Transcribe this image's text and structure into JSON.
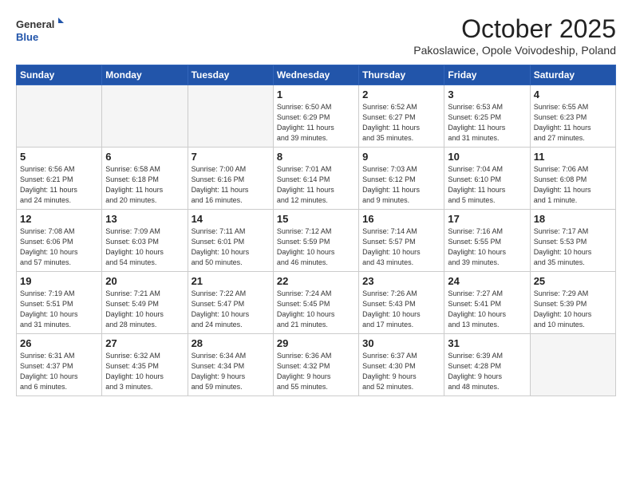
{
  "header": {
    "logo_general": "General",
    "logo_blue": "Blue",
    "title": "October 2025",
    "subtitle": "Pakoslawice, Opole Voivodeship, Poland"
  },
  "weekdays": [
    "Sunday",
    "Monday",
    "Tuesday",
    "Wednesday",
    "Thursday",
    "Friday",
    "Saturday"
  ],
  "weeks": [
    [
      {
        "day": "",
        "info": ""
      },
      {
        "day": "",
        "info": ""
      },
      {
        "day": "",
        "info": ""
      },
      {
        "day": "1",
        "info": "Sunrise: 6:50 AM\nSunset: 6:29 PM\nDaylight: 11 hours\nand 39 minutes."
      },
      {
        "day": "2",
        "info": "Sunrise: 6:52 AM\nSunset: 6:27 PM\nDaylight: 11 hours\nand 35 minutes."
      },
      {
        "day": "3",
        "info": "Sunrise: 6:53 AM\nSunset: 6:25 PM\nDaylight: 11 hours\nand 31 minutes."
      },
      {
        "day": "4",
        "info": "Sunrise: 6:55 AM\nSunset: 6:23 PM\nDaylight: 11 hours\nand 27 minutes."
      }
    ],
    [
      {
        "day": "5",
        "info": "Sunrise: 6:56 AM\nSunset: 6:21 PM\nDaylight: 11 hours\nand 24 minutes."
      },
      {
        "day": "6",
        "info": "Sunrise: 6:58 AM\nSunset: 6:18 PM\nDaylight: 11 hours\nand 20 minutes."
      },
      {
        "day": "7",
        "info": "Sunrise: 7:00 AM\nSunset: 6:16 PM\nDaylight: 11 hours\nand 16 minutes."
      },
      {
        "day": "8",
        "info": "Sunrise: 7:01 AM\nSunset: 6:14 PM\nDaylight: 11 hours\nand 12 minutes."
      },
      {
        "day": "9",
        "info": "Sunrise: 7:03 AM\nSunset: 6:12 PM\nDaylight: 11 hours\nand 9 minutes."
      },
      {
        "day": "10",
        "info": "Sunrise: 7:04 AM\nSunset: 6:10 PM\nDaylight: 11 hours\nand 5 minutes."
      },
      {
        "day": "11",
        "info": "Sunrise: 7:06 AM\nSunset: 6:08 PM\nDaylight: 11 hours\nand 1 minute."
      }
    ],
    [
      {
        "day": "12",
        "info": "Sunrise: 7:08 AM\nSunset: 6:06 PM\nDaylight: 10 hours\nand 57 minutes."
      },
      {
        "day": "13",
        "info": "Sunrise: 7:09 AM\nSunset: 6:03 PM\nDaylight: 10 hours\nand 54 minutes."
      },
      {
        "day": "14",
        "info": "Sunrise: 7:11 AM\nSunset: 6:01 PM\nDaylight: 10 hours\nand 50 minutes."
      },
      {
        "day": "15",
        "info": "Sunrise: 7:12 AM\nSunset: 5:59 PM\nDaylight: 10 hours\nand 46 minutes."
      },
      {
        "day": "16",
        "info": "Sunrise: 7:14 AM\nSunset: 5:57 PM\nDaylight: 10 hours\nand 43 minutes."
      },
      {
        "day": "17",
        "info": "Sunrise: 7:16 AM\nSunset: 5:55 PM\nDaylight: 10 hours\nand 39 minutes."
      },
      {
        "day": "18",
        "info": "Sunrise: 7:17 AM\nSunset: 5:53 PM\nDaylight: 10 hours\nand 35 minutes."
      }
    ],
    [
      {
        "day": "19",
        "info": "Sunrise: 7:19 AM\nSunset: 5:51 PM\nDaylight: 10 hours\nand 31 minutes."
      },
      {
        "day": "20",
        "info": "Sunrise: 7:21 AM\nSunset: 5:49 PM\nDaylight: 10 hours\nand 28 minutes."
      },
      {
        "day": "21",
        "info": "Sunrise: 7:22 AM\nSunset: 5:47 PM\nDaylight: 10 hours\nand 24 minutes."
      },
      {
        "day": "22",
        "info": "Sunrise: 7:24 AM\nSunset: 5:45 PM\nDaylight: 10 hours\nand 21 minutes."
      },
      {
        "day": "23",
        "info": "Sunrise: 7:26 AM\nSunset: 5:43 PM\nDaylight: 10 hours\nand 17 minutes."
      },
      {
        "day": "24",
        "info": "Sunrise: 7:27 AM\nSunset: 5:41 PM\nDaylight: 10 hours\nand 13 minutes."
      },
      {
        "day": "25",
        "info": "Sunrise: 7:29 AM\nSunset: 5:39 PM\nDaylight: 10 hours\nand 10 minutes."
      }
    ],
    [
      {
        "day": "26",
        "info": "Sunrise: 6:31 AM\nSunset: 4:37 PM\nDaylight: 10 hours\nand 6 minutes."
      },
      {
        "day": "27",
        "info": "Sunrise: 6:32 AM\nSunset: 4:35 PM\nDaylight: 10 hours\nand 3 minutes."
      },
      {
        "day": "28",
        "info": "Sunrise: 6:34 AM\nSunset: 4:34 PM\nDaylight: 9 hours\nand 59 minutes."
      },
      {
        "day": "29",
        "info": "Sunrise: 6:36 AM\nSunset: 4:32 PM\nDaylight: 9 hours\nand 55 minutes."
      },
      {
        "day": "30",
        "info": "Sunrise: 6:37 AM\nSunset: 4:30 PM\nDaylight: 9 hours\nand 52 minutes."
      },
      {
        "day": "31",
        "info": "Sunrise: 6:39 AM\nSunset: 4:28 PM\nDaylight: 9 hours\nand 48 minutes."
      },
      {
        "day": "",
        "info": ""
      }
    ]
  ]
}
